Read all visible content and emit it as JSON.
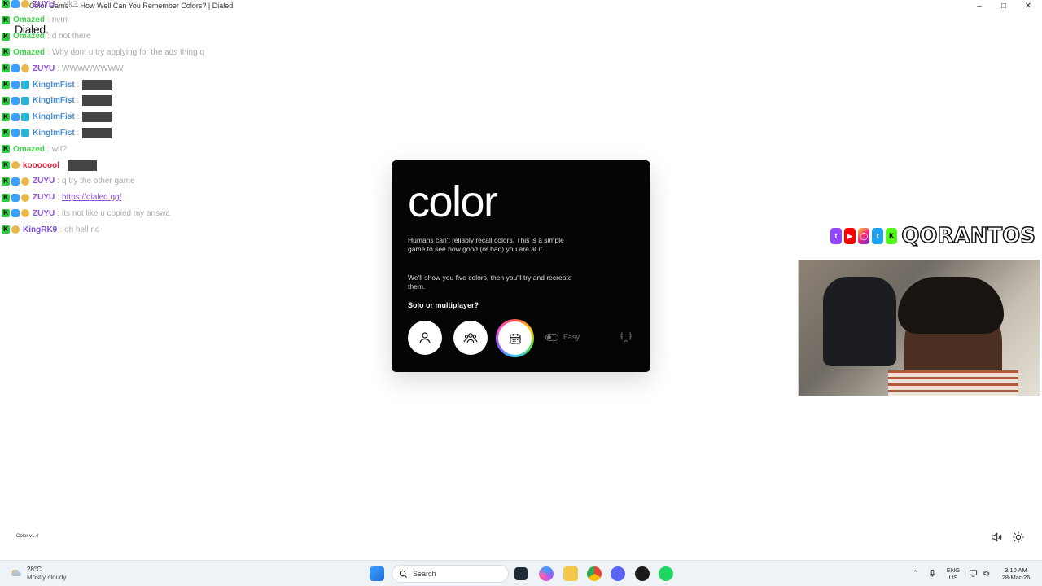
{
  "window": {
    "title": "Color Game — How Well Can You Remember Colors? | Dialed",
    "brand": "Dialed."
  },
  "chat": [
    {
      "badges": [
        "k",
        "cube",
        "moon"
      ],
      "user": "ZUYU",
      "user_color": "#8a4fd8",
      "message": "afk?",
      "emote": false
    },
    {
      "badges": [
        "k"
      ],
      "user": "Omazed",
      "user_color": "#3fd24a",
      "message": "nvm",
      "emote": false
    },
    {
      "badges": [
        "k"
      ],
      "user": "Omazed",
      "user_color": "#3fd24a",
      "message": "d not there",
      "emote": false
    },
    {
      "badges": [
        "k"
      ],
      "user": "Omazed",
      "user_color": "#3fd24a",
      "message": "Why dont u try applying for the ads thing q",
      "emote": false
    },
    {
      "badges": [
        "k",
        "cube",
        "moon"
      ],
      "user": "ZUYU",
      "user_color": "#8a4fd8",
      "message": "WWWWWWWW",
      "emote": false
    },
    {
      "badges": [
        "k",
        "cube",
        "grid"
      ],
      "user": "KingImFist",
      "user_color": "#4a8fd6",
      "message": "",
      "emote": true
    },
    {
      "badges": [
        "k",
        "cube",
        "grid"
      ],
      "user": "KingImFist",
      "user_color": "#4a8fd6",
      "message": "",
      "emote": true
    },
    {
      "badges": [
        "k",
        "cube",
        "grid"
      ],
      "user": "KingImFist",
      "user_color": "#4a8fd6",
      "message": "",
      "emote": true
    },
    {
      "badges": [
        "k",
        "cube",
        "grid"
      ],
      "user": "KingImFist",
      "user_color": "#4a8fd6",
      "message": "",
      "emote": true
    },
    {
      "badges": [
        "k"
      ],
      "user": "Omazed",
      "user_color": "#3fd24a",
      "message": "wtf?",
      "emote": false
    },
    {
      "badges": [
        "k",
        "moon"
      ],
      "user": "kooooool",
      "user_color": "#d8243f",
      "message": "",
      "emote": true
    },
    {
      "badges": [
        "k",
        "cube",
        "moon"
      ],
      "user": "ZUYU",
      "user_color": "#8a4fd8",
      "message": "q try the other game",
      "emote": false
    },
    {
      "badges": [
        "k",
        "cube",
        "moon"
      ],
      "user": "ZUYU",
      "user_color": "#8a4fd8",
      "message": "https://dialed.gg/",
      "emote": false
    },
    {
      "badges": [
        "k",
        "cube",
        "moon"
      ],
      "user": "ZUYU",
      "user_color": "#8a4fd8",
      "message": "its not like u copied my answa",
      "emote": false
    },
    {
      "badges": [
        "k",
        "moon"
      ],
      "user": "KingRK9",
      "user_color": "#7a4fd8",
      "message": "oh hell no",
      "emote": false
    }
  ],
  "card": {
    "title": "color",
    "description": "Humans can't reliably recall colors. This is a simple game to see how good (or bad) you are at it.",
    "description2": "We'll show you five colors, then you'll try and recreate them.",
    "question": "Solo or multiplayer?",
    "easy_label": "Easy",
    "easy_on": false
  },
  "overlay": {
    "channel_name": "QORANTOS",
    "socials": [
      "twitch-icon",
      "youtube-icon",
      "instagram-icon",
      "twitter-icon",
      "kick-icon"
    ]
  },
  "footer": {
    "version": "Color v1.4"
  },
  "taskbar": {
    "weather_temp": "28°C",
    "weather_desc": "Mostly cloudy",
    "search_placeholder": "Search",
    "lang_top": "ENG",
    "lang_bottom": "US",
    "time": "3:10 AM",
    "date": "28-Mar-26"
  }
}
